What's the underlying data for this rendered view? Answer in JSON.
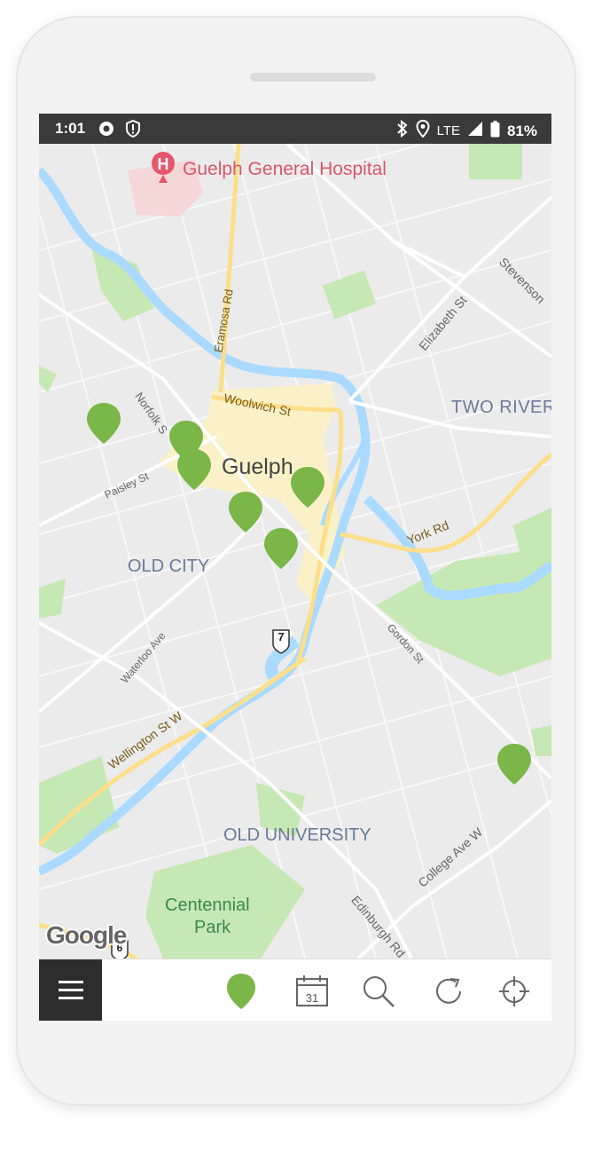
{
  "status_bar": {
    "time": "1:01",
    "network": "LTE",
    "battery": "81%",
    "icons": [
      "target-icon",
      "shield-icon",
      "bluetooth-icon",
      "location-icon",
      "signal-icon",
      "battery-icon"
    ]
  },
  "map": {
    "labels": {
      "hospital": "Guelph General Hospital",
      "eramosa": "Eramosa Rd",
      "elizabeth": "Elizabeth St",
      "stevenson": "Stevenson",
      "two_rivers": "TWO RIVER",
      "woolwich": "Woolwich St",
      "norfolk": "Norfolk S",
      "paisley": "Paisley St",
      "guelph": "Guelph",
      "york": "York Rd",
      "old_city": "OLD CITY",
      "waterloo": "Waterloo Ave",
      "gordon": "Gordon St",
      "highway_7": "7",
      "wellington": "Wellington St W",
      "old_university": "OLD UNIVERSITY",
      "college": "College Ave W",
      "centennial": "Centennial",
      "park": "Park",
      "edinburgh": "Edinburgh Rd",
      "highway_6": "6",
      "google": "Google"
    },
    "pin_color": "#7ab648",
    "pin_count": 8
  },
  "toolbar": {
    "items": [
      "menu-icon",
      "map-pin-icon",
      "calendar-icon",
      "search-icon",
      "refresh-icon",
      "locate-icon"
    ],
    "calendar_day": "31"
  },
  "colors": {
    "status_bar": "#3a3a3a",
    "menu_button": "#2d2d2d",
    "water": "#aadaff",
    "park": "#c6e8b4",
    "downtown": "#fbf1c8",
    "arterial": "#fbdf8a"
  }
}
